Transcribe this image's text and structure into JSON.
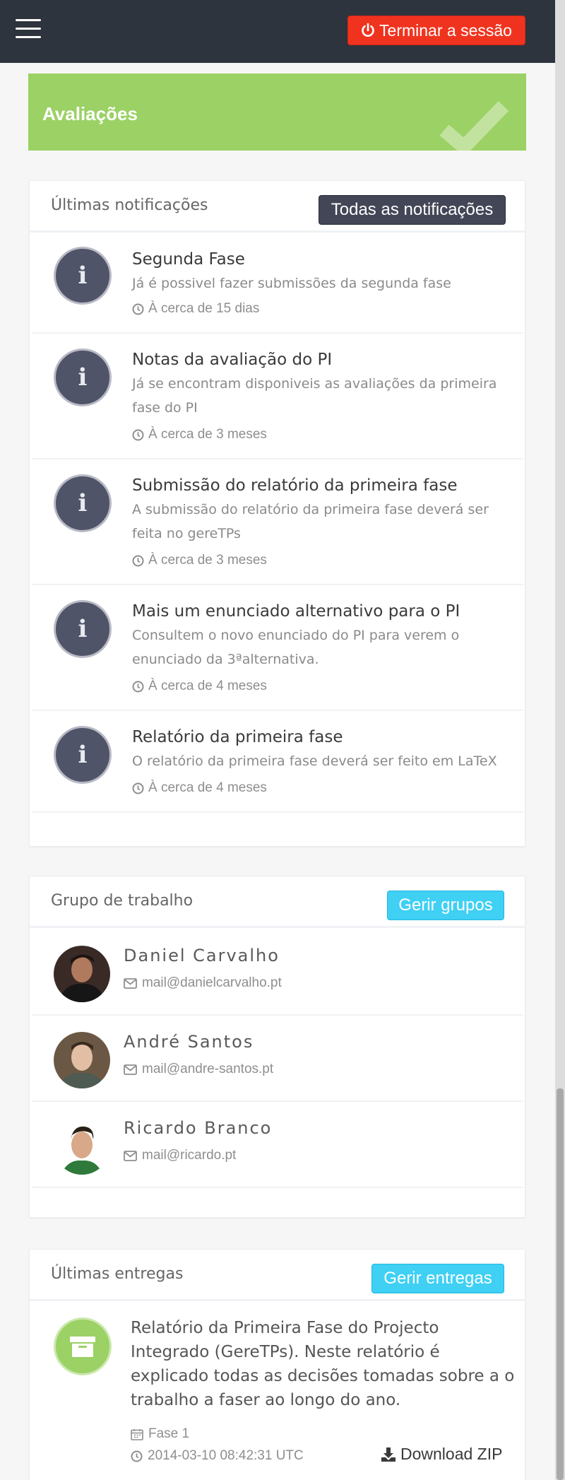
{
  "header": {
    "logout_label": "Terminar a sessão"
  },
  "banner": {
    "title": "Avaliações",
    "color": "#9bd165"
  },
  "notifications": {
    "title": "Últimas notificações",
    "all_button": "Todas as notificações",
    "items": [
      {
        "title": "Segunda Fase",
        "body": "Já é possivel fazer submissões da segunda fase",
        "time": "À cerca de 15 dias"
      },
      {
        "title": "Notas da avaliação do PI",
        "body": "Já se encontram disponiveis as avaliações da primeira fase do PI",
        "time": "À cerca de 3 meses"
      },
      {
        "title": "Submissão do relatório da primeira fase",
        "body": "A submissão do relatório da primeira fase deverá ser feita no gereTPs",
        "time": "À cerca de 3 meses"
      },
      {
        "title": "Mais um enunciado alternativo para o PI",
        "body": "Consultem o novo enunciado do PI para verem o enunciado da 3ªalternativa.",
        "time": "À cerca de 4 meses"
      },
      {
        "title": "Relatório da primeira fase",
        "body": "O relatório da primeira fase deverá ser feito em LaTeX",
        "time": "À cerca de 4 meses"
      }
    ]
  },
  "group": {
    "title": "Grupo de trabalho",
    "manage_button": "Gerir grupos",
    "members": [
      {
        "name": "Daniel Carvalho",
        "email": "mail@danielcarvalho.pt"
      },
      {
        "name": "André Santos",
        "email": "mail@andre-santos.pt"
      },
      {
        "name": "Ricardo Branco",
        "email": "mail@ricardo.pt"
      }
    ]
  },
  "deliveries": {
    "title": "Últimas entregas",
    "manage_button": "Gerir entregas",
    "items": [
      {
        "description": "Relatório da Primeira Fase do Projecto Integrado (GereTPs). Neste relatório é explicado todas as decisões tomadas sobre a o trabalho a faser ao longo do ano.",
        "phase": "Fase 1",
        "timestamp": "2014-03-10 08:42:31 UTC",
        "download_label": "Download ZIP"
      }
    ]
  },
  "colors": {
    "topbar": "#2e343d",
    "logout": "#f0331f",
    "accent_cyan": "#3fd0f4",
    "info_icon": "#505468"
  }
}
